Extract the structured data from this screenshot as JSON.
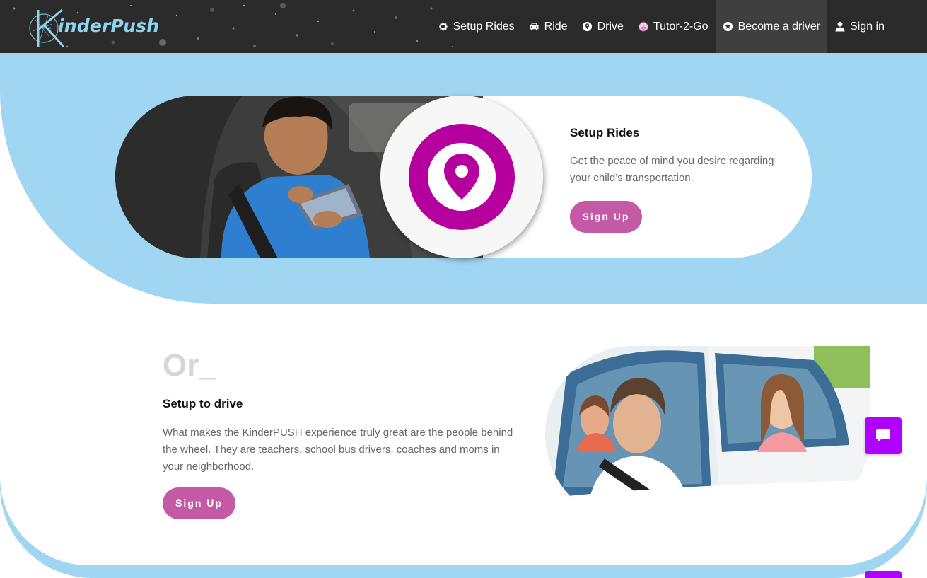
{
  "brand": {
    "name": "KinderPush",
    "logo_text": "inderPush"
  },
  "nav": {
    "items": [
      {
        "label": "Setup Rides",
        "icon": "gear-icon"
      },
      {
        "label": "Ride",
        "icon": "car-icon"
      },
      {
        "label": "Drive",
        "icon": "map-marker-icon"
      },
      {
        "label": "Tutor-2-Go",
        "icon": "tutor-icon"
      },
      {
        "label": "Become a driver",
        "icon": "star-circle-icon",
        "active": true
      },
      {
        "label": "Sign in",
        "icon": "user-icon"
      }
    ]
  },
  "hero": {
    "title": "Setup Rides",
    "description": "Get the peace of mind you desire regarding your child’s transportation.",
    "button": "Sign Up",
    "photo_icon": "location-pin-icon",
    "photo_alt": "boy with tablet in car seat"
  },
  "drive": {
    "or_label": "Or_",
    "title": "Setup to drive",
    "description": "What makes the KinderPUSH experience truly great are the people behind the wheel. They are teachers, school bus drivers, coaches and moms in your neighborhood.",
    "button": "Sign Up",
    "photo_alt": "woman driving with children"
  },
  "chat": {
    "icon": "chat-bubble-icon"
  },
  "colors": {
    "navbar": "#2b2b2b",
    "band": "#a0d6f2",
    "accent_button": "#c45aa6",
    "pin_magenta": "#b5009e",
    "chat": "#b000ff",
    "logo": "#8fd3ec"
  }
}
